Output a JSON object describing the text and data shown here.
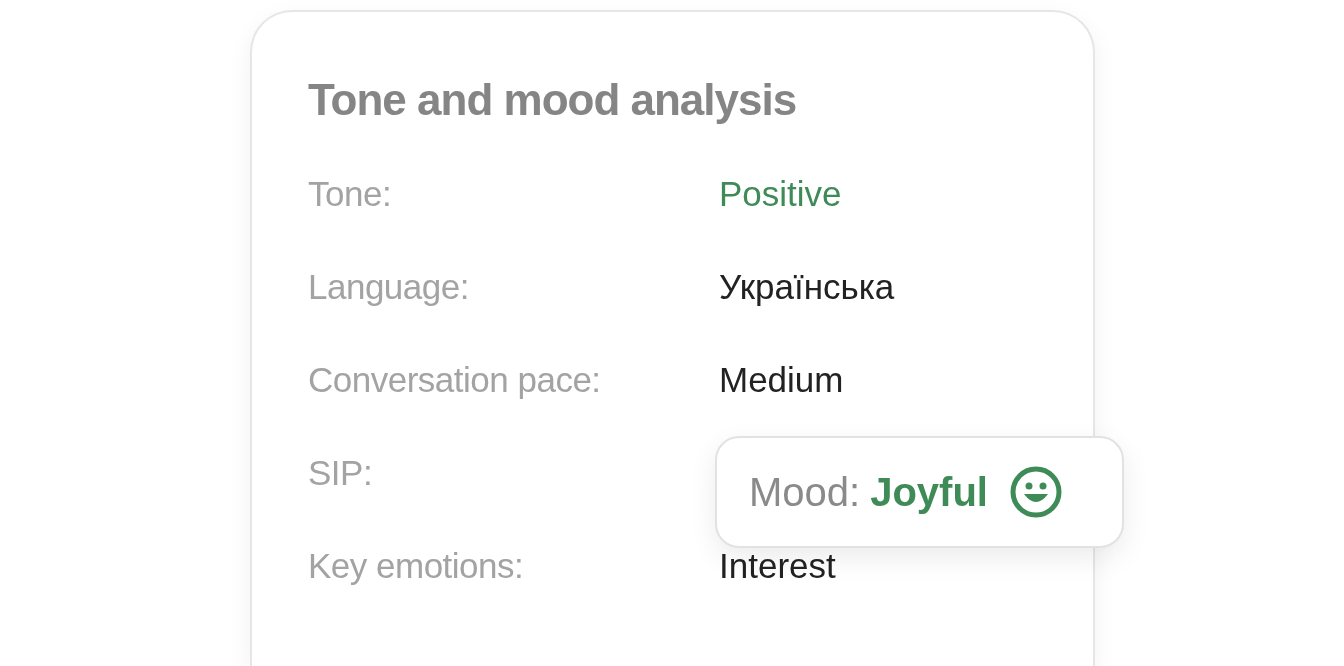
{
  "card": {
    "title": "Tone and mood analysis",
    "rows": [
      {
        "label": "Tone:",
        "value": "Positive",
        "kind": "positive"
      },
      {
        "label": "Language:",
        "value": "Українська",
        "kind": "plain"
      },
      {
        "label": "Conversation pace:",
        "value": "Medium",
        "kind": "plain"
      },
      {
        "label": "SIP:"
      },
      {
        "label": "Key emotions:",
        "value": "Interest",
        "kind": "plain"
      }
    ]
  },
  "mood_popup": {
    "label": "Mood:",
    "value": "Joyful"
  }
}
